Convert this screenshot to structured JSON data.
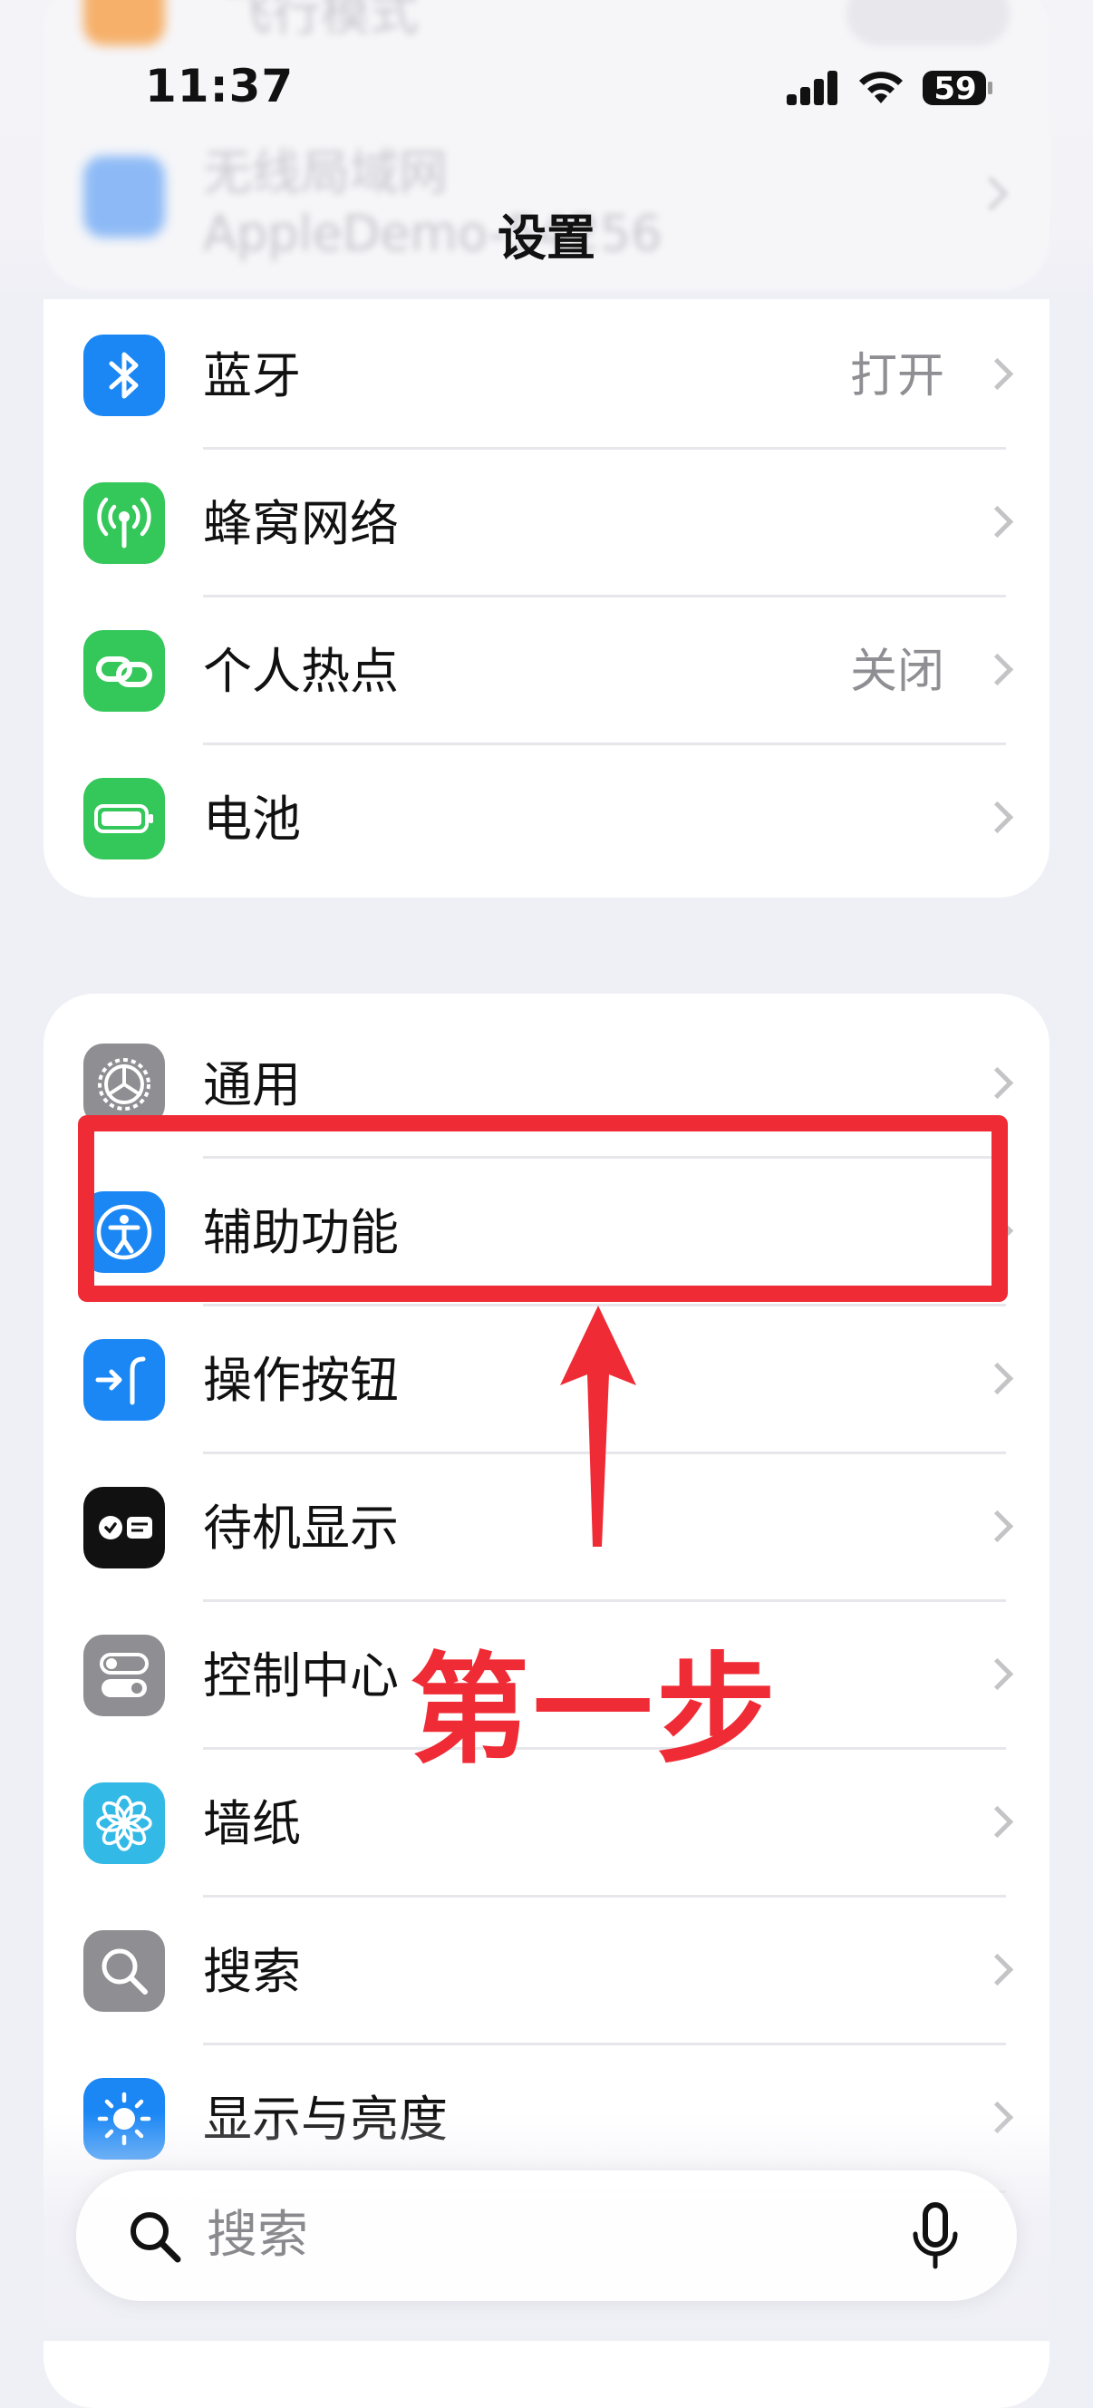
{
  "status_bar": {
    "time": "11:37",
    "battery": "59"
  },
  "ghost_rows": {
    "row1": "飞行模式",
    "row2_title": "无线局域网",
    "row2_sub": "AppleDemo-54256"
  },
  "nav": {
    "title": "设置"
  },
  "group1": {
    "items": [
      {
        "label": "蓝牙",
        "value": "打开",
        "icon": "bluetooth-icon",
        "color": "#1a87f5"
      },
      {
        "label": "蜂窝网络",
        "value": "",
        "icon": "cellular-icon",
        "color": "#34c759"
      },
      {
        "label": "个人热点",
        "value": "关闭",
        "icon": "hotspot-icon",
        "color": "#34c759"
      },
      {
        "label": "电池",
        "value": "",
        "icon": "battery-icon",
        "color": "#34c759"
      }
    ]
  },
  "group2": {
    "items": [
      {
        "label": "通用",
        "icon": "gear-icon",
        "color": "#8e8e93"
      },
      {
        "label": "辅助功能",
        "icon": "accessibility-icon",
        "color": "#1a87f5"
      },
      {
        "label": "操作按钮",
        "icon": "action-button-icon",
        "color": "#1a87f5"
      },
      {
        "label": "待机显示",
        "icon": "standby-icon",
        "color": "#111111"
      },
      {
        "label": "控制中心",
        "icon": "control-center-icon",
        "color": "#8e8e93"
      },
      {
        "label": "墙纸",
        "icon": "wallpaper-icon",
        "color": "#32b9e6"
      },
      {
        "label": "搜索",
        "icon": "search-icon",
        "color": "#8e8e93"
      },
      {
        "label": "显示与亮度",
        "icon": "brightness-icon",
        "color": "#1a87f5"
      }
    ]
  },
  "annotation": {
    "step_text": "第一步",
    "color": "#ef2b35"
  },
  "search_bar": {
    "placeholder": "搜索"
  }
}
